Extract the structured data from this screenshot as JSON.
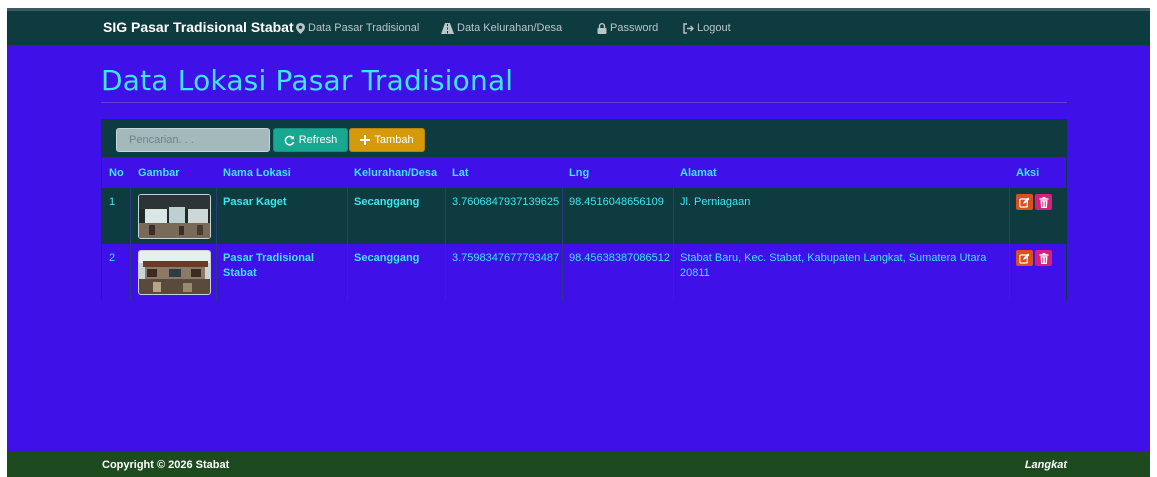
{
  "navbar": {
    "brand": "SIG Pasar Tradisional Stabat",
    "items": [
      {
        "label": "Data Pasar Tradisional",
        "icon": "map-marker-icon"
      },
      {
        "label": "Data Kelurahan/Desa",
        "icon": "road-icon"
      },
      {
        "label": "Password",
        "icon": "lock-icon"
      },
      {
        "label": "Logout",
        "icon": "logout-icon"
      }
    ]
  },
  "page": {
    "title": "Data Lokasi Pasar Tradisional"
  },
  "toolbar": {
    "search_placeholder": "Pencarian. . .",
    "refresh_label": "Refresh",
    "add_label": "Tambah"
  },
  "table": {
    "columns": [
      "No",
      "Gambar",
      "Nama Lokasi",
      "Kelurahan/Desa",
      "Lat",
      "Lng",
      "Alamat",
      "Aksi"
    ],
    "rows": [
      {
        "no": "1",
        "nama": "Pasar Kaget",
        "kelurahan": "Secanggang",
        "lat": "3.7606847937139625",
        "lng": "98.4516048656109",
        "alamat": "Jl. Perniagaan"
      },
      {
        "no": "2",
        "nama": "Pasar Tradisional Stabat",
        "kelurahan": "Secanggang",
        "lat": "3.7598347677793487",
        "lng": "98.45638387086512",
        "alamat": "Stabat Baru, Kec. Stabat, Kabupaten Langkat, Sumatera Utara 20811"
      }
    ]
  },
  "footer": {
    "copyright": "Copyright © 2026 Stabat",
    "right": "Langkat"
  },
  "colors": {
    "navbar": "#0d3b3f",
    "background": "#3f10e8",
    "accent_text": "#3fe6f0",
    "refresh_button": "#18a892",
    "add_button": "#d49a0c",
    "edit_button": "#d8501f",
    "delete_button": "#d6207c",
    "footer": "#1d4a1f"
  }
}
